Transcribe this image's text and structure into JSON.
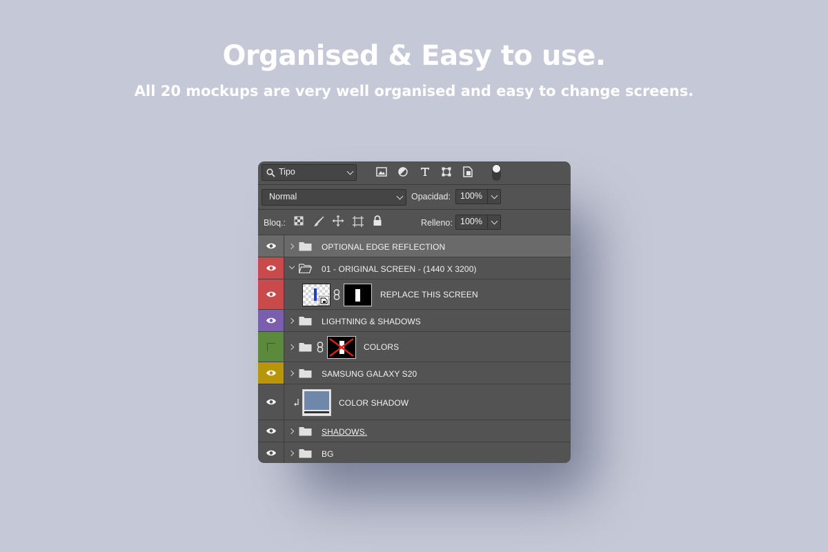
{
  "heading": {
    "title": "Organised & Easy to use.",
    "subtitle": "All 20 mockups are very well organised and easy to change screens."
  },
  "toolbar": {
    "filter_kind": "Tipo",
    "filter_icons": [
      "image-filter-icon",
      "adjustment-filter-icon",
      "type-filter-icon",
      "shape-filter-icon",
      "smart-object-filter-icon"
    ],
    "blend_mode": "Normal",
    "opacity_label": "Opacidad:",
    "opacity_value": "100%",
    "lock_label": "Bloq.:",
    "lock_icons": [
      "lock-transparent-icon",
      "lock-paint-icon",
      "lock-position-icon",
      "lock-artboard-icon",
      "lock-all-icon"
    ],
    "fill_label": "Relleno:",
    "fill_value": "100%"
  },
  "layers": [
    {
      "name": "OPTIONAL EDGE REFLECTION",
      "type": "group",
      "color": "none",
      "visible": true,
      "selected": true
    },
    {
      "name": "01 - ORIGINAL SCREEN - (1440 X 3200)",
      "type": "group",
      "color": "#c94a4a",
      "visible": true,
      "expanded": true
    },
    {
      "name": "REPLACE THIS SCREEN",
      "type": "smart-object",
      "color": "#c94a4a",
      "visible": true,
      "has_mask": true
    },
    {
      "name": "LIGHTNING & SHADOWS",
      "type": "group",
      "color": "#7b5fae",
      "visible": true
    },
    {
      "name": "COLORS",
      "type": "group",
      "color": "#5c8a3c",
      "visible": false,
      "has_mask": true
    },
    {
      "name": "SAMSUNG GALAXY S20",
      "type": "group",
      "color": "#b8960c",
      "visible": true
    },
    {
      "name": "COLOR SHADOW",
      "type": "layer",
      "color": "none",
      "visible": true,
      "clipped": true,
      "thumb_color": "#6f88aa"
    },
    {
      "name": "SHADOWS.",
      "type": "group",
      "color": "none",
      "visible": true
    },
    {
      "name": "BG",
      "type": "group",
      "color": "none",
      "visible": true
    }
  ],
  "colors": {
    "background": "#c5c8d6",
    "panel": "#535353",
    "selected_row": "#6a6a6a",
    "red_tag": "#c94a4a",
    "violet_tag": "#7b5fae",
    "green_tag": "#5c8a3c",
    "yellow_tag": "#b8960c"
  }
}
